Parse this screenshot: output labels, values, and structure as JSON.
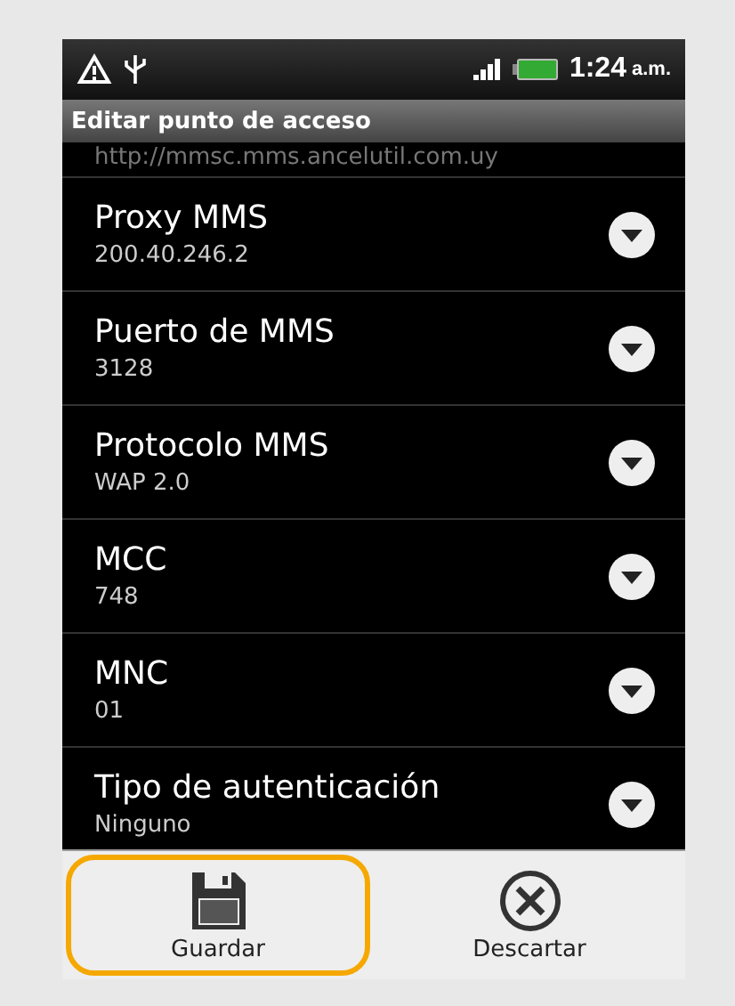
{
  "status_bar": {
    "time": "1:24",
    "ampm": "a.m."
  },
  "title_bar": {
    "title": "Editar punto de acceso"
  },
  "partial_value": "http://mmsc.mms.ancelutil.com.uy",
  "settings": [
    {
      "label": "Proxy MMS",
      "value": "200.40.246.2"
    },
    {
      "label": "Puerto de MMS",
      "value": "3128"
    },
    {
      "label": "Protocolo MMS",
      "value": "WAP 2.0"
    },
    {
      "label": "MCC",
      "value": "748"
    },
    {
      "label": "MNC",
      "value": "01"
    },
    {
      "label": "Tipo de autenticación",
      "value": "Ninguno"
    }
  ],
  "actions": [
    {
      "kind": "save",
      "label": "Guardar",
      "highlighted": true
    },
    {
      "kind": "discard",
      "label": "Descartar",
      "highlighted": false
    }
  ]
}
